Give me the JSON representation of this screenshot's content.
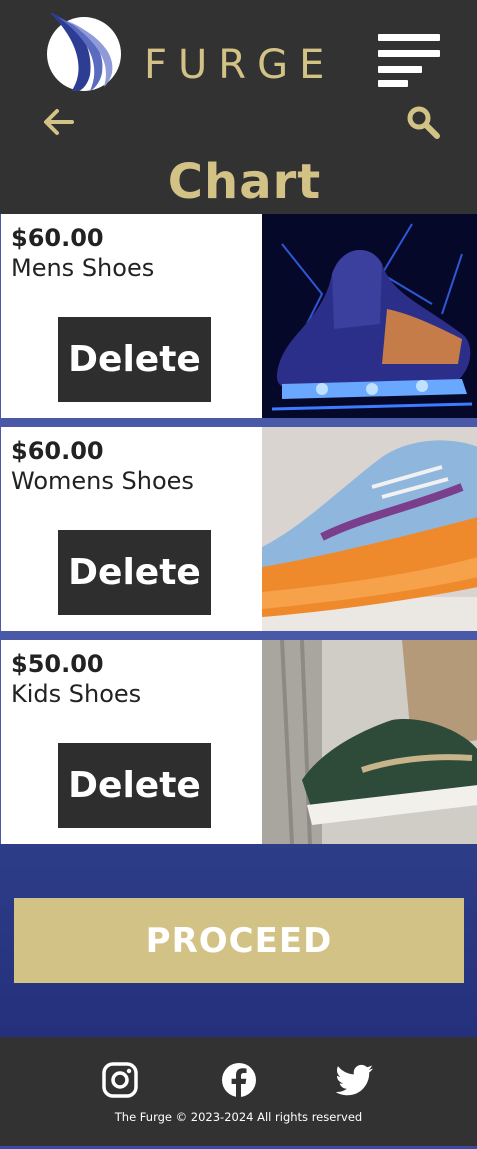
{
  "header": {
    "brand": "FURGE",
    "title": "Chart",
    "accent_color": "#d3c286",
    "icons": {
      "menu": "hamburger-menu-icon",
      "back": "arrow-left-icon",
      "search": "search-icon"
    }
  },
  "cart": {
    "items": [
      {
        "price": "$60.00",
        "name": "Mens Shoes",
        "delete_label": "Delete",
        "image": "mens-sneaker-image"
      },
      {
        "price": "$60.00",
        "name": "Womens Shoes",
        "delete_label": "Delete",
        "image": "womens-sneaker-image"
      },
      {
        "price": "$50.00",
        "name": "Kids Shoes",
        "delete_label": "Delete",
        "image": "kids-sneaker-image"
      }
    ]
  },
  "checkout": {
    "proceed_label": "PROCEED"
  },
  "footer": {
    "social": [
      "instagram-icon",
      "facebook-icon",
      "twitter-icon"
    ],
    "copyright": "The Furge © 2023-2024 All rights reserved"
  }
}
